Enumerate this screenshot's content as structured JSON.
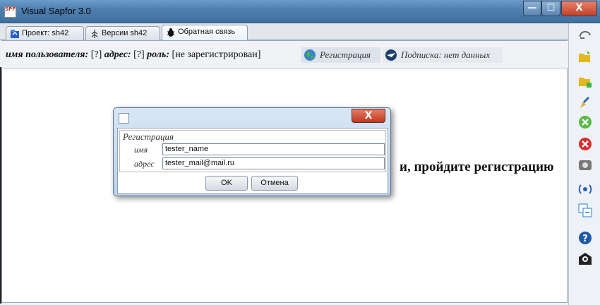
{
  "window": {
    "title": "Visual Sapfor 3.0",
    "app_icon_text": "SPF",
    "minimize": "—",
    "maximize": "☐",
    "close": "X"
  },
  "tabs": [
    {
      "label": "Проект: sh42",
      "icon": "project-icon"
    },
    {
      "label": "Версии sh42",
      "icon": "versions-tree-icon"
    },
    {
      "label": "Обратная связь",
      "icon": "feedback-bug-icon",
      "active": true
    }
  ],
  "userbar": {
    "user_label": "имя пользователя:",
    "user_value": "[?]",
    "address_label": "адрес:",
    "address_value": "[?]",
    "role_label": "роль:",
    "role_value": "[не зарегистрирован]",
    "register_link": "Регистрация",
    "subscription_link": "Подписка: нет данных"
  },
  "background_message": "и, пройдите регистрацию",
  "dialog": {
    "section_title": "Регистрация",
    "name_label": "имя",
    "name_value": "tester_name",
    "address_label": "адрес",
    "address_value": "tester_mail@mail.ru",
    "ok_label": "OK",
    "cancel_label": "Отмена",
    "close": "X"
  },
  "sidebar_icons": [
    "sync-icon",
    "open-folder-icon",
    "new-folder-icon",
    "clean-brush-icon",
    "confirm-icon",
    "cancel-icon",
    "camera-icon",
    "signal-icon",
    "translate-icon",
    "help-icon",
    "mail-icon"
  ],
  "colors": {
    "titlebar": "#4f80b0",
    "close_button": "#c2412a",
    "panel": "#ffffff"
  }
}
